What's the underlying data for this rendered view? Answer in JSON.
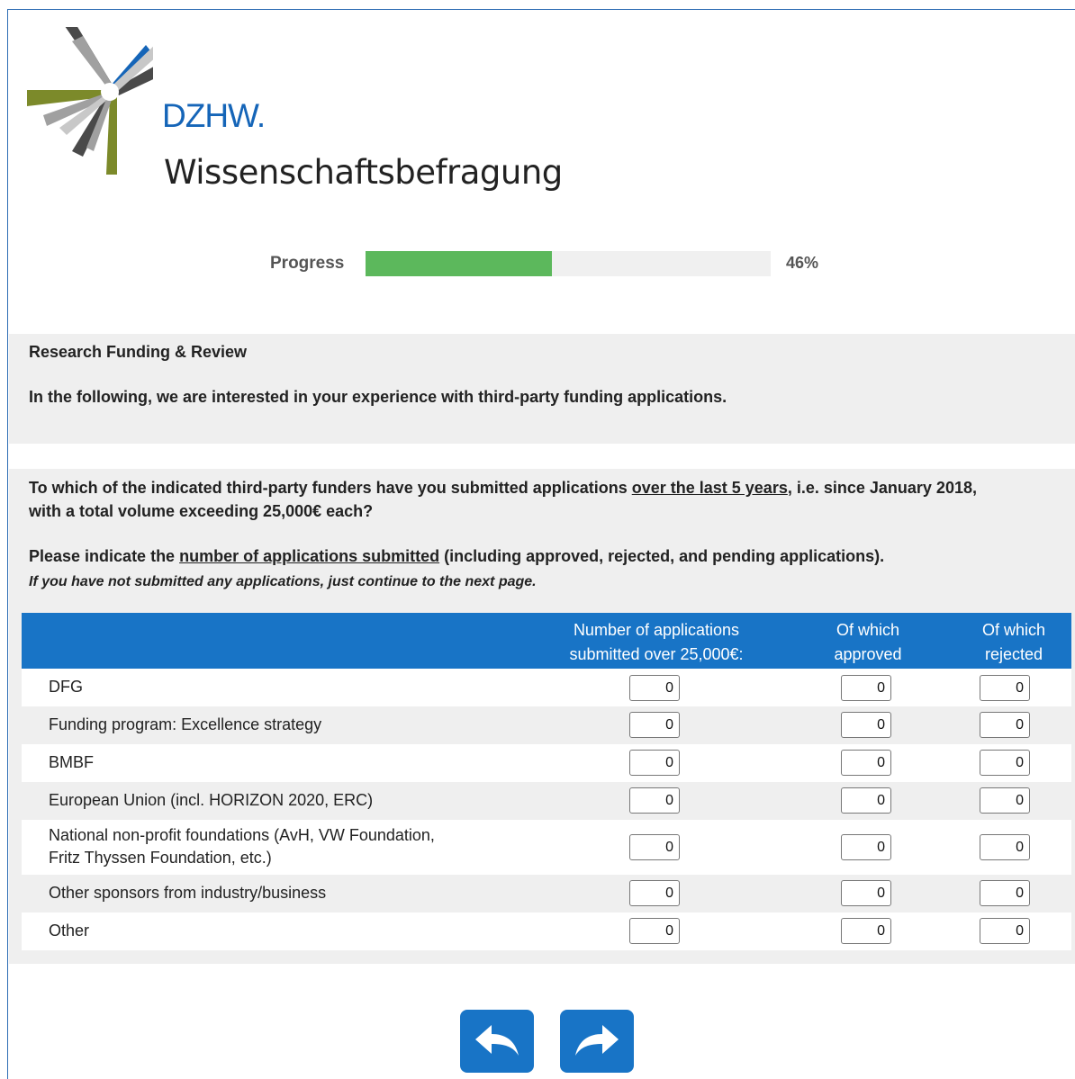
{
  "logo": {
    "brand_line1": "DZHW.",
    "brand_line2": "Wissenschaftsbefragung"
  },
  "progress": {
    "label": "Progress",
    "value": 0.46,
    "text": "46%",
    "fill_color": "#5cb85c"
  },
  "intro": {
    "title": "Research Funding & Review",
    "text": "In the following, we are interested in your experience with third-party funding applications."
  },
  "question": {
    "line1_pre": "To which of the indicated third-party funders have you submitted applications ",
    "line1_underlined": "over the last 5 years",
    "line1_post": ", i.e. since January 2018,",
    "line2": "with a total volume exceeding 25,000€ each?",
    "line3_pre": "Please indicate the ",
    "line3_underlined": "number of applications submitted",
    "line3_post": " (including approved, rejected, and pending applications).",
    "hint": "If you have not submitted any applications, just continue to the next page."
  },
  "table": {
    "header_color": "#1874c6",
    "columns": [
      {
        "line1": "Number of applications",
        "line2": "submitted over 25,000€:"
      },
      {
        "line1": "Of which",
        "line2": "approved"
      },
      {
        "line1": "Of which",
        "line2": "rejected"
      }
    ],
    "rows": [
      {
        "label_line1": "DFG",
        "label_line2": "",
        "values": [
          "0",
          "0",
          "0"
        ]
      },
      {
        "label_line1": "Funding program: Excellence strategy",
        "label_line2": "",
        "values": [
          "0",
          "0",
          "0"
        ]
      },
      {
        "label_line1": "BMBF",
        "label_line2": "",
        "values": [
          "0",
          "0",
          "0"
        ]
      },
      {
        "label_line1": "European Union (incl. HORIZON 2020, ERC)",
        "label_line2": "",
        "values": [
          "0",
          "0",
          "0"
        ]
      },
      {
        "label_line1": "National non-profit foundations (AvH, VW Foundation,",
        "label_line2": "Fritz Thyssen Foundation, etc.)",
        "values": [
          "0",
          "0",
          "0"
        ]
      },
      {
        "label_line1": "Other sponsors from industry/business",
        "label_line2": "",
        "values": [
          "0",
          "0",
          "0"
        ]
      },
      {
        "label_line1": "Other",
        "label_line2": "",
        "values": [
          "0",
          "0",
          "0"
        ]
      }
    ]
  },
  "nav": {
    "back_icon": "arrow-back-icon",
    "next_icon": "arrow-forward-icon",
    "button_color": "#1874c6"
  }
}
